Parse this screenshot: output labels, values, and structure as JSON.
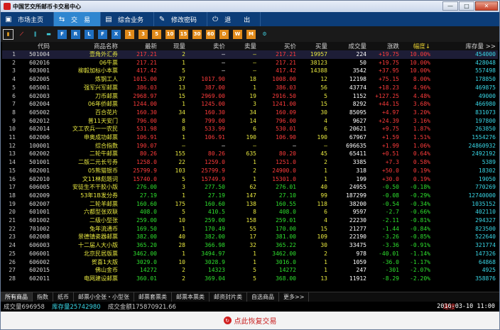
{
  "window": {
    "title": "中国艺交所邮币卡交易中心",
    "min": "—",
    "max": "□",
    "close": "✕"
  },
  "menu": [
    {
      "label": "市场主页",
      "icon": "home-icon",
      "glyph": "▣"
    },
    {
      "label": "交　易",
      "icon": "trade-icon",
      "glyph": "⇆"
    },
    {
      "label": "综合业务",
      "icon": "business-icon",
      "glyph": "▤"
    },
    {
      "label": "修改密码",
      "icon": "key-icon",
      "glyph": "✎"
    },
    {
      "label": "退　　出",
      "icon": "power-icon",
      "glyph": "⏻"
    }
  ],
  "toolbar": [
    {
      "name": "bar-chart-icon",
      "glyph": "▮",
      "cls": "sel"
    },
    {
      "name": "line-chart-icon",
      "glyph": "⟋",
      "cls": ""
    },
    {
      "name": "candle-icon",
      "glyph": "‖",
      "cls": ""
    },
    {
      "name": "window-icon",
      "glyph": "▬",
      "cls": ""
    },
    {
      "name": "tb-f1",
      "glyph": "F",
      "cls": "sq"
    },
    {
      "name": "tb-f2",
      "glyph": "R",
      "cls": "sq"
    },
    {
      "name": "tb-f3",
      "glyph": "L",
      "cls": "sq"
    },
    {
      "name": "tb-f4",
      "glyph": "F",
      "cls": "sq"
    },
    {
      "name": "tb-f5",
      "glyph": "X",
      "cls": "sq"
    },
    {
      "name": "tb-o1",
      "glyph": "1",
      "cls": "or"
    },
    {
      "name": "tb-o2",
      "glyph": "3",
      "cls": "or"
    },
    {
      "name": "tb-o3",
      "glyph": "5",
      "cls": "or"
    },
    {
      "name": "tb-o4",
      "glyph": "10",
      "cls": "or"
    },
    {
      "name": "tb-o5",
      "glyph": "15",
      "cls": "or"
    },
    {
      "name": "tb-o6",
      "glyph": "30",
      "cls": "or"
    },
    {
      "name": "tb-o7",
      "glyph": "60",
      "cls": "or"
    },
    {
      "name": "tb-o8",
      "glyph": "D",
      "cls": "or"
    },
    {
      "name": "tb-o9",
      "glyph": "W",
      "cls": "or"
    },
    {
      "name": "tb-o10",
      "glyph": "M",
      "cls": "or"
    },
    {
      "name": "settings-gear-icon",
      "glyph": "⚙",
      "cls": ""
    }
  ],
  "columns": [
    "",
    "代码",
    "商品名称",
    "最新",
    "现量",
    "卖价",
    "卖量",
    "买价",
    "买量",
    "成交量",
    "涨跌",
    "幅度↓",
    "库存量 >>"
  ],
  "rows": [
    [
      "1",
      "501004",
      "壹角外汇券",
      "217.21",
      "2",
      "—",
      "—",
      "217.21",
      "19957",
      "224",
      "+19.75",
      "10.00%",
      "454000"
    ],
    [
      "2",
      "602016",
      "06牛票",
      "217.21",
      "1",
      "—",
      "—",
      "217.21",
      "38123",
      "50",
      "+19.75",
      "10.00%",
      "428048"
    ],
    [
      "3",
      "603001",
      "柳毅加标小本票",
      "417.42",
      "5",
      "—",
      "—",
      "417.42",
      "14388",
      "3542",
      "+37.95",
      "10.00%",
      "557498"
    ],
    [
      "4",
      "602005",
      "炼钢工人",
      "1015.00",
      "37",
      "1017.90",
      "18",
      "1008.00",
      "12",
      "12198",
      "+75.15",
      "8.00%",
      "178850"
    ],
    [
      "5",
      "605001",
      "强军兴军邮票",
      "386.03",
      "13",
      "387.00",
      "1",
      "386.03",
      "56",
      "43774",
      "+18.23",
      "4.96%",
      "469875"
    ],
    [
      "6",
      "602003",
      "刀币邮票",
      "2968.97",
      "15",
      "2969.00",
      "19",
      "2916.50",
      "5",
      "1152",
      "+127.25",
      "4.48%",
      "49000"
    ],
    [
      "7",
      "602004",
      "06年侨邮票",
      "1244.00",
      "1",
      "1245.00",
      "3",
      "1241.00",
      "15",
      "8292",
      "+44.15",
      "3.68%",
      "466980"
    ],
    [
      "8",
      "605002",
      "百合花片",
      "160.30",
      "34",
      "160.30",
      "34",
      "160.09",
      "30",
      "85095",
      "+4.97",
      "3.20%",
      "831073"
    ],
    [
      "9",
      "602012",
      "普11天安门",
      "796.00",
      "8",
      "799.00",
      "14",
      "796.00",
      "4",
      "9627",
      "+24.39",
      "3.16%",
      "197800"
    ],
    [
      "10",
      "602014",
      "文工农兵一一农民",
      "531.98",
      "8",
      "533.99",
      "6",
      "530.01",
      "6",
      "20621",
      "+9.75",
      "1.87%",
      "263850"
    ],
    [
      "11",
      "602006",
      "申奥成功邮票",
      "106.91",
      "1",
      "106.91",
      "190",
      "106.90",
      "190",
      "67967",
      "+1.59",
      "1.51%",
      "1554276"
    ],
    [
      "12",
      "100001",
      "综合指数",
      "190.07",
      "—",
      "—",
      "—",
      "—",
      "—",
      "696635",
      "+1.99",
      "1.06%",
      "24860932"
    ],
    [
      "13",
      "602002",
      "二轮牛邮票",
      "80.26",
      "155",
      "80.26",
      "635",
      "80.20",
      "45",
      "65411",
      "+0.51",
      "0.64%",
      "2492192"
    ],
    [
      "14",
      "501001",
      "二版二元长号券",
      "1258.0",
      "22",
      "1259.0",
      "1",
      "1251.0",
      "2",
      "3385",
      "+7.3",
      "0.58%",
      "5389"
    ],
    [
      "15",
      "602001",
      "05熊猫银币",
      "25799.9",
      "103",
      "25799.9",
      "2",
      "24900.0",
      "1",
      "318",
      "+50.0",
      "0.19%",
      "18302"
    ],
    [
      "16",
      "602010",
      "文11林彪题词",
      "15740.0",
      "5",
      "15749.9",
      "1",
      "15301.0",
      "1",
      "199",
      "+30.0",
      "0.19%",
      "19050"
    ],
    [
      "17",
      "606005",
      "安徒生不干胶小版",
      "276.00",
      "3",
      "277.50",
      "62",
      "276.01",
      "40",
      "24955",
      "-0.50",
      "-0.18%",
      "770269"
    ],
    [
      "18",
      "602009",
      "53年1B发分券",
      "27.19",
      "1",
      "27.19",
      "147",
      "27.10",
      "99",
      "187299",
      "-0.08",
      "-0.29%",
      "12740000"
    ],
    [
      "19",
      "602007",
      "二轮羊邮票",
      "160.60",
      "175",
      "160.60",
      "138",
      "160.55",
      "118",
      "38200",
      "-0.54",
      "-0.34%",
      "1035152"
    ],
    [
      "20",
      "601001",
      "六都型张双联",
      "408.0",
      "5",
      "410.5",
      "8",
      "408.0",
      "6",
      "9597",
      "-2.7",
      "-0.66%",
      "402110"
    ],
    [
      "21",
      "601002",
      "二级小型张",
      "259.00",
      "10",
      "259.00",
      "158",
      "259.01",
      "4",
      "22230",
      "-2.11",
      "-0.81%",
      "294327"
    ],
    [
      "22",
      "701002",
      "兔年流通币",
      "169.50",
      "1",
      "170.49",
      "55",
      "170.00",
      "15",
      "21277",
      "-1.44",
      "-0.84%",
      "823500"
    ],
    [
      "23",
      "602008",
      "景德镇瓷器邮票",
      "382.00",
      "40",
      "382.00",
      "17",
      "381.00",
      "109",
      "22190",
      "-3.26",
      "-0.85%",
      "522640"
    ],
    [
      "24",
      "606003",
      "十二届人大小版",
      "365.20",
      "28",
      "366.98",
      "32",
      "365.22",
      "30",
      "33475",
      "-3.36",
      "-0.91%",
      "321774"
    ],
    [
      "25",
      "606001",
      "北京民居版票",
      "3462.00",
      "1",
      "3494.97",
      "1",
      "3462.00",
      "2",
      "978",
      "-40.01",
      "-1.14%",
      "147326"
    ],
    [
      "26",
      "606002",
      "贺喜1大版",
      "3029.0",
      "10",
      "3028.9",
      "1",
      "3016.0",
      "1",
      "1059",
      "-36.0",
      "-1.17%",
      "64868"
    ],
    [
      "27",
      "602015",
      "佛山金币",
      "14272",
      "2",
      "14323",
      "5",
      "14272",
      "1",
      "247",
      "-301",
      "-2.07%",
      "4925"
    ],
    [
      "28",
      "602011",
      "电网建设邮票",
      "360.01",
      "2",
      "369.04",
      "5",
      "368.00",
      "13",
      "11912",
      "-8.29",
      "-2.20%",
      "358876"
    ]
  ],
  "tabs": [
    "所有商品",
    "指数",
    "纸币",
    "邮票小全张・小型张",
    "邮票套票类",
    "邮票本票类",
    "邮资封片类",
    "自选商品",
    "更多>>"
  ],
  "status": {
    "volume": "成交量696958",
    "stock": "库存量25742980",
    "amount": "成交金额175870921.66",
    "connection": "连接",
    "time": "2016-03-10 11:00"
  },
  "restore_label": "点此恢复交易",
  "colors": {
    "up": "#ff3c3c",
    "down": "#2ee02e",
    "name": "#e8e840",
    "menubar": "#0c3d78",
    "menu_active": "#2f86d0"
  }
}
